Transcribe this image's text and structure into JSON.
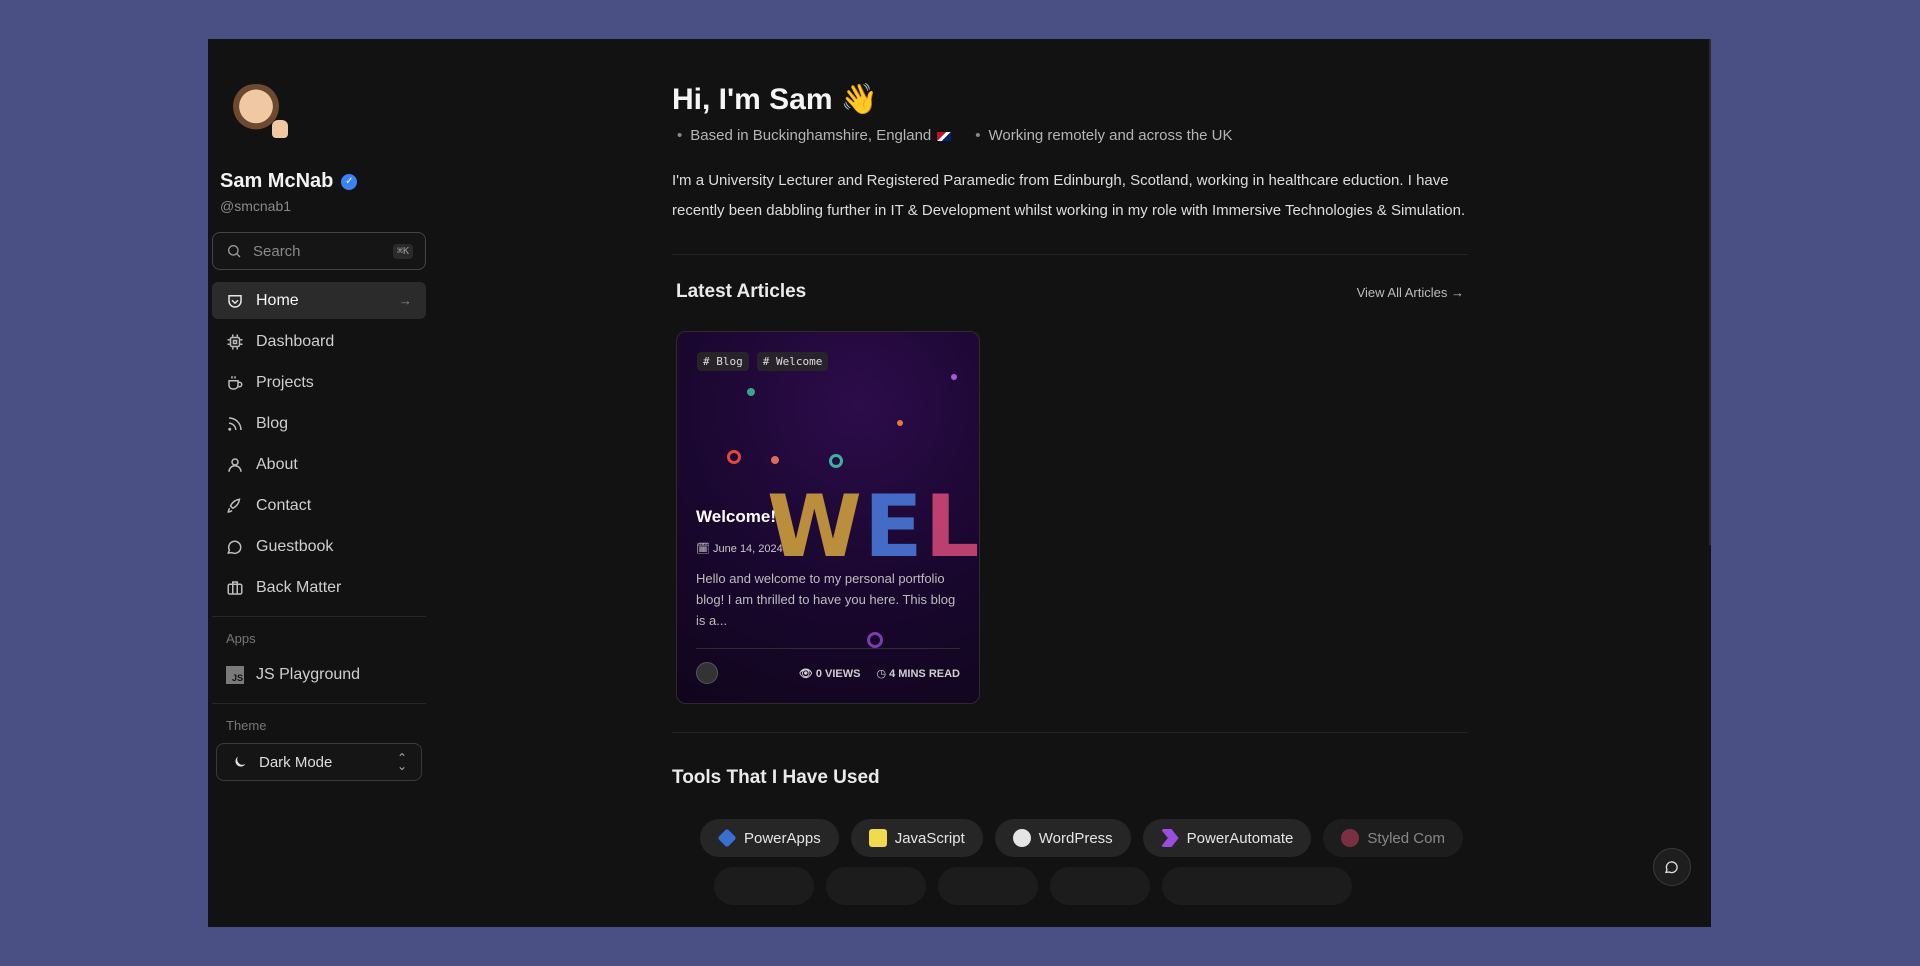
{
  "profile": {
    "name": "Sam McNab",
    "handle": "@smcnab1"
  },
  "search": {
    "placeholder": "Search",
    "shortcut": "⌘K"
  },
  "nav": {
    "items": [
      {
        "label": "Home",
        "icon": "home-icon",
        "active": true
      },
      {
        "label": "Dashboard",
        "icon": "chip-icon"
      },
      {
        "label": "Projects",
        "icon": "cup-icon"
      },
      {
        "label": "Blog",
        "icon": "rss-icon"
      },
      {
        "label": "About",
        "icon": "user-icon"
      },
      {
        "label": "Contact",
        "icon": "rocket-icon"
      },
      {
        "label": "Guestbook",
        "icon": "chat-icon"
      },
      {
        "label": "Back Matter",
        "icon": "briefcase-icon"
      }
    ]
  },
  "apps": {
    "label": "Apps",
    "items": [
      {
        "label": "JS Playground",
        "icon": "js-icon"
      }
    ]
  },
  "theme": {
    "label": "Theme",
    "value": "Dark Mode"
  },
  "hero": {
    "title": "Hi, I'm Sam 👋",
    "location": "Based in Buckinghamshire, England",
    "remote": "Working remotely and across the UK",
    "bio": "I'm a University Lecturer and Registered Paramedic from Edinburgh, Scotland, working in healthcare eduction. I have recently been dabbling further in IT & Development whilst working in my role with Immersive Technologies & Simulation."
  },
  "articles": {
    "title": "Latest Articles",
    "view_all": "View All Articles",
    "items": [
      {
        "tags": [
          "Blog",
          "Welcome"
        ],
        "title": "Welcome!",
        "date": "June 14, 2024",
        "excerpt": "Hello and welcome to my personal portfolio blog! I am thrilled to have you here. This blog is a...",
        "views": "0 VIEWS",
        "read_time": "4 MINS READ",
        "cover_text": "WELC"
      }
    ]
  },
  "tools": {
    "title": "Tools That I Have Used",
    "row1": [
      {
        "label": "PowerApps",
        "color": "#3a6ed0"
      },
      {
        "label": "JavaScript",
        "color": "#f0db4f"
      },
      {
        "label": "WordPress",
        "color": "#e5e5e5"
      },
      {
        "label": "PowerAutomate",
        "color": "#9b4de0"
      },
      {
        "label": "Styled Com",
        "color": "#d04a6a"
      }
    ]
  },
  "colors": {
    "background": "#4a5084",
    "panel": "#121212",
    "accent": "#3b82f6"
  }
}
